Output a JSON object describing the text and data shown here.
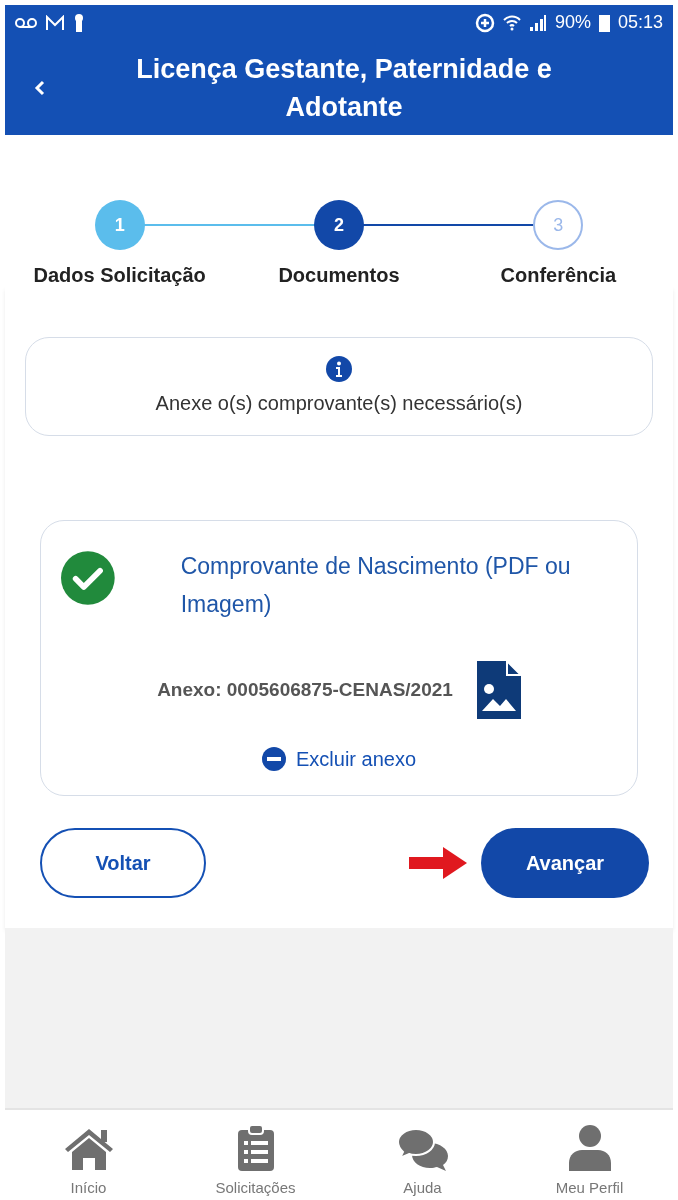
{
  "status_bar": {
    "battery": "90%",
    "time": "05:13"
  },
  "header": {
    "title": "Licença Gestante, Paternidade e Adotante"
  },
  "steps": [
    {
      "number": "1",
      "label": "Dados Solicitação",
      "kind": "done"
    },
    {
      "number": "2",
      "label": "Documentos",
      "kind": "current"
    },
    {
      "number": "3",
      "label": "Conferência",
      "kind": "pending"
    }
  ],
  "info": {
    "text": "Anexe o(s) comprovante(s) necessário(s)"
  },
  "document": {
    "title": "Comprovante de Nascimento (PDF ou Imagem)",
    "checked": true,
    "attachment": "Anexo: 0005606875-CENAS/2021",
    "remove_label": "Excluir anexo"
  },
  "buttons": {
    "back": "Voltar",
    "next": "Avançar"
  },
  "nav": [
    {
      "label": "Início",
      "kind": "home"
    },
    {
      "label": "Solicitações",
      "kind": "clipboard"
    },
    {
      "label": "Ajuda",
      "kind": "chat"
    },
    {
      "label": "Meu Perfil",
      "kind": "person"
    }
  ]
}
